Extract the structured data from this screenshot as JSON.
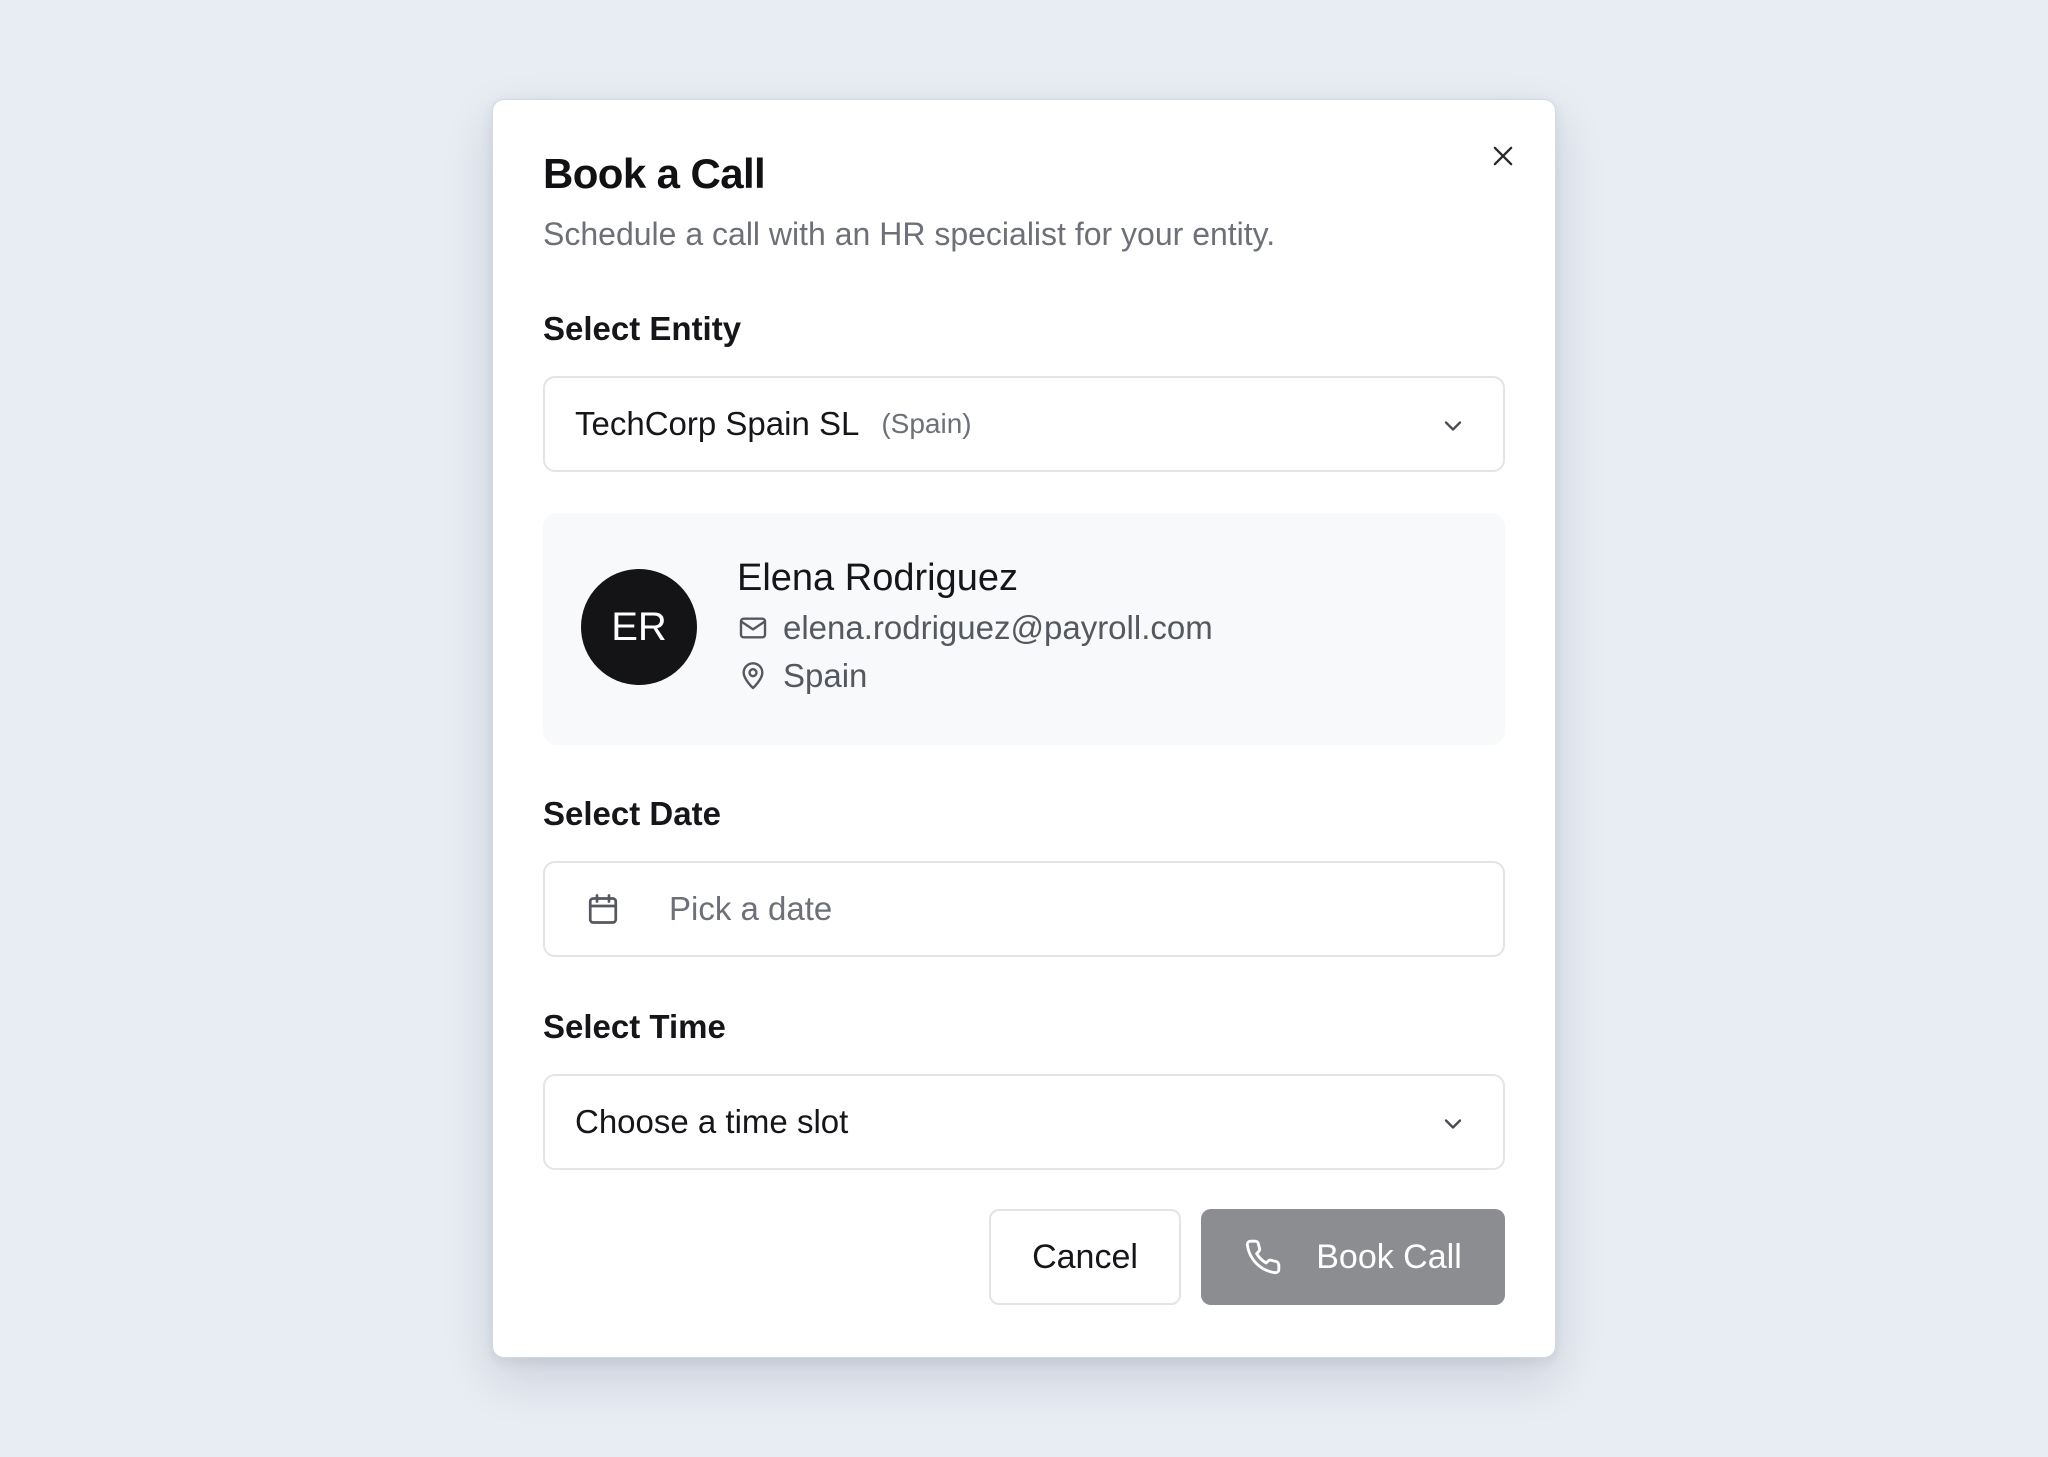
{
  "dialog": {
    "title": "Book a Call",
    "subtitle": "Schedule a call with an HR specialist for your entity."
  },
  "entity": {
    "label": "Select Entity",
    "selected_name": "TechCorp Spain SL",
    "selected_country": "(Spain)"
  },
  "specialist": {
    "initials": "ER",
    "name": "Elena Rodriguez",
    "email": "elena.rodriguez@payroll.com",
    "location": "Spain"
  },
  "date": {
    "label": "Select Date",
    "placeholder": "Pick a date"
  },
  "time": {
    "label": "Select Time",
    "placeholder": "Choose a time slot"
  },
  "actions": {
    "cancel_label": "Cancel",
    "book_label": "Book Call"
  },
  "icons": {
    "close": "close-icon",
    "chevron": "chevron-down-icon",
    "mail": "mail-icon",
    "location": "map-pin-icon",
    "calendar": "calendar-icon",
    "phone": "phone-icon"
  },
  "colors": {
    "background": "#e8ecf3",
    "avatar": "#141416",
    "book_button_disabled": "#8c8d90",
    "muted_text": "#6d7079"
  }
}
